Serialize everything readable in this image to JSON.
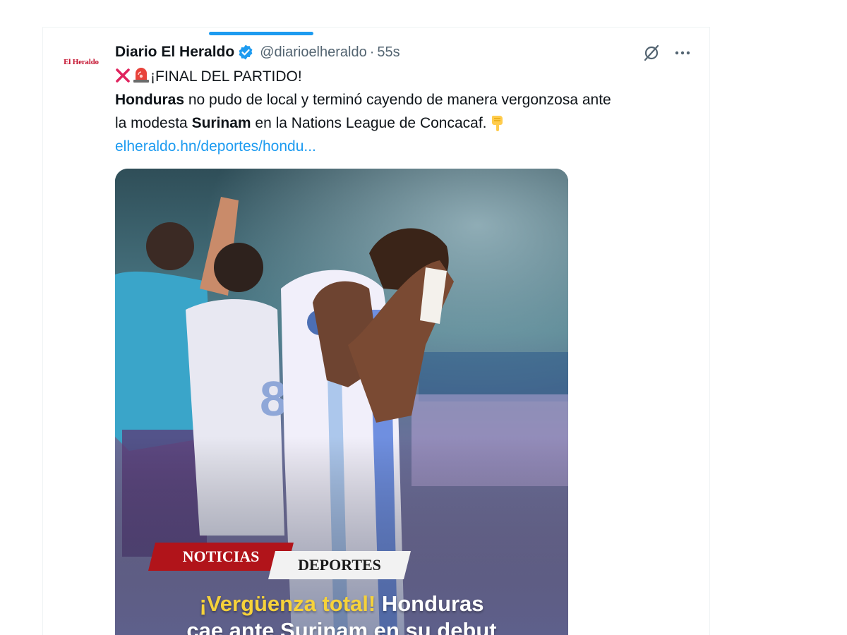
{
  "tweet": {
    "author": {
      "avatar_text": "El Heraldo",
      "name": "Diario El Heraldo",
      "handle": "@diarioelheraldo",
      "separator": "·",
      "time": "55s",
      "verified": true
    },
    "text": {
      "line1": "¡FINAL DEL PARTIDO!",
      "line2_bold": "Honduras",
      "line2_rest": " no pudo de local y terminó cayendo de manera vergonzosa ante",
      "line3_start": "la modesta ",
      "line3_bold": "Surinam",
      "line3_rest": " en la Nations League de Concacaf.",
      "link": "elheraldo.hn/deportes/hondu..."
    },
    "icons": {
      "emoji_1": "cross-mark-icon",
      "emoji_2": "siren-icon",
      "emoji_3": "pointing-down-icon",
      "header_actions": [
        "grok-icon",
        "more-icon"
      ]
    },
    "media": {
      "tag_1": "NOTICIAS",
      "tag_2": "DEPORTES",
      "headline_accent": "¡Vergüenza total!",
      "headline_rest": " Honduras",
      "headline_line2": "cae ante Surinam en su debut"
    }
  },
  "colors": {
    "accent": "#1d9bf0",
    "text_primary": "#0f1419",
    "text_secondary": "#536471",
    "brand_red": "#c4122f"
  }
}
